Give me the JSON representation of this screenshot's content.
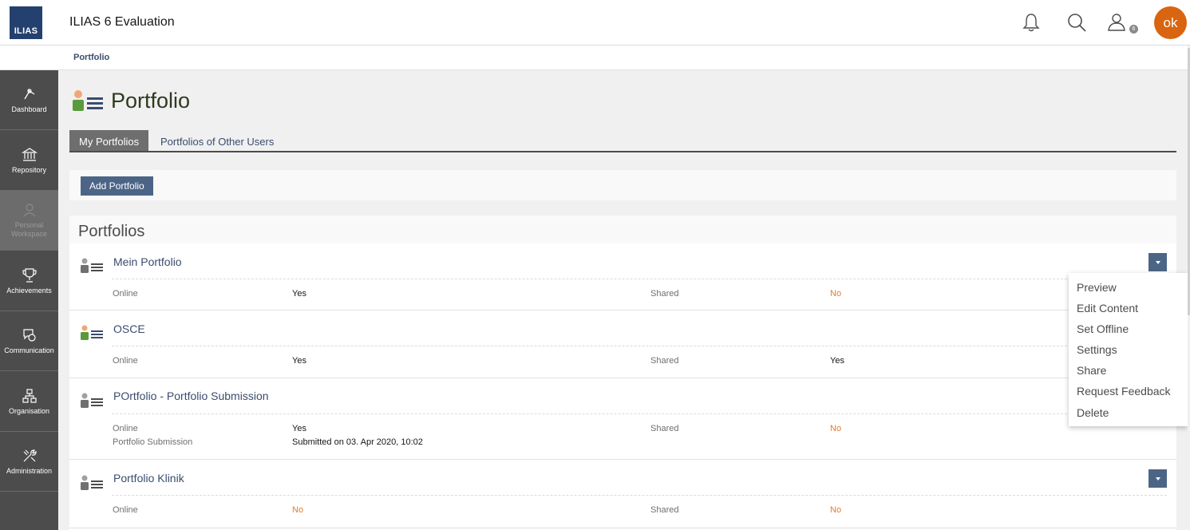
{
  "header": {
    "logo_text": "ILIAS",
    "app_title": "ILIAS 6 Evaluation",
    "notifications_icon": "bell-icon",
    "search_icon": "search-icon",
    "contacts_icon": "contacts-icon",
    "contacts_badge": "6",
    "avatar_initials": "ok",
    "avatar_color": "#d96510"
  },
  "breadcrumb": {
    "item": "Portfolio"
  },
  "sidebar": {
    "items": [
      {
        "label": "Dashboard",
        "icon": "dashboard-icon"
      },
      {
        "label": "Repository",
        "icon": "repository-icon"
      },
      {
        "label": "Personal Workspace",
        "icon": "workspace-icon",
        "active": true
      },
      {
        "label": "Achievements",
        "icon": "trophy-icon"
      },
      {
        "label": "Communication",
        "icon": "communication-icon"
      },
      {
        "label": "Organisation",
        "icon": "organisation-icon"
      },
      {
        "label": "Administration",
        "icon": "administration-icon"
      }
    ]
  },
  "main": {
    "title": "Portfolio",
    "tabs": [
      {
        "label": "My Portfolios",
        "active": true
      },
      {
        "label": "Portfolios of Other Users",
        "active": false
      }
    ],
    "toolbar": {
      "add_label": "Add Portfolio"
    },
    "panel_title": "Portfolios",
    "portfolios": [
      {
        "title": "Mein Portfolio",
        "online_label": "Online",
        "online_value": "Yes",
        "shared_label": "Shared",
        "shared_value": "No"
      },
      {
        "title": "OSCE",
        "online_label": "Online",
        "online_value": "Yes",
        "shared_label": "Shared",
        "shared_value": "Yes"
      },
      {
        "title": "POrtfolio - Portfolio Submission",
        "online_label": "Online",
        "online_value": "Yes",
        "submission_label": "Portfolio Submission",
        "submission_value": "Submitted on 03. Apr 2020, 10:02",
        "shared_label": "Shared",
        "shared_value": "No"
      },
      {
        "title": "Portfolio Klinik",
        "online_label": "Online",
        "online_value": "No",
        "shared_label": "Shared",
        "shared_value": "No"
      }
    ]
  },
  "dropdown_menu": {
    "items": [
      "Preview",
      "Edit Content",
      "Set Offline",
      "Settings",
      "Share",
      "Request Feedback",
      "Delete"
    ]
  },
  "colors": {
    "accent": "#4c6586",
    "warning": "#e8792c",
    "sidebar": "#4c4c4c",
    "link": "#3a4c6e"
  }
}
